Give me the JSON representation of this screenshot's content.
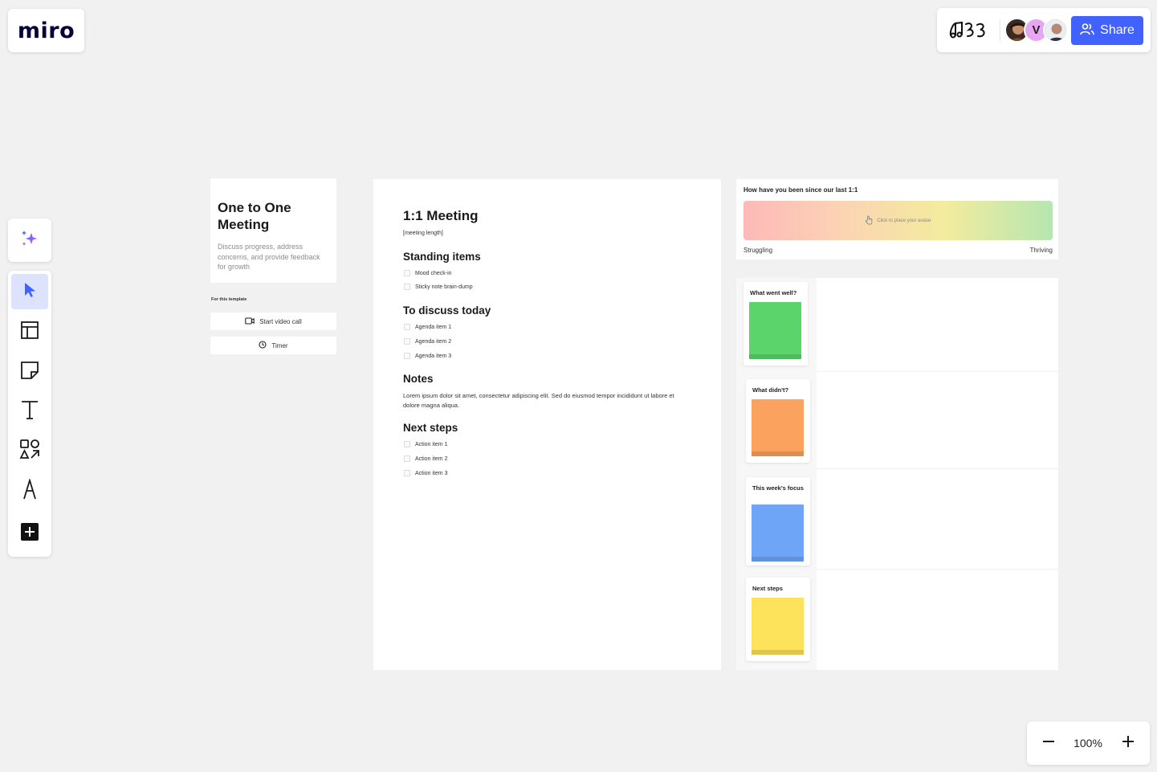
{
  "app": {
    "logo": "miro"
  },
  "topbar": {
    "avatars": [
      {
        "name": "avatar-photo-1"
      },
      {
        "initial": "V"
      },
      {
        "name": "avatar-photo-2"
      }
    ],
    "share_label": "Share"
  },
  "toolbar": {
    "items": [
      "ai-sparkle",
      "select",
      "templates",
      "sticky-note",
      "text",
      "shapes",
      "pen",
      "more"
    ]
  },
  "intro": {
    "title": "One to One Meeting",
    "description": "Discuss progress, address concerns, and provide feedback for growth",
    "for_template": "For this template",
    "video_call_label": "Start video call",
    "timer_label": "Timer"
  },
  "doc": {
    "title": "1:1 Meeting",
    "subtitle": "[meeting length]",
    "standing_heading": "Standing items",
    "standing_items": [
      "Mood check-in",
      "Sticky note brain-dump"
    ],
    "discuss_heading": "To discuss today",
    "discuss_items": [
      "Agenda item 1",
      "Agenda item 2",
      "Agenda item 3"
    ],
    "notes_heading": "Notes",
    "notes_text": "Lorem ipsum dolor sit amet, consectetur adipiscing elit. Sed do eiusmod tempor incididunt ut labore et dolore magna aliqua.",
    "next_heading": "Next steps",
    "next_items": [
      "Action item 1",
      "Action item 2",
      "Action item 3"
    ]
  },
  "mood": {
    "question": "How have you been since our last 1:1",
    "hint": "Click to place your avatar",
    "left_label": "Struggling",
    "right_label": "Thriving"
  },
  "retro": {
    "cards": [
      {
        "label": "What went well?",
        "color": "#5bd46b"
      },
      {
        "label": "What didn't?",
        "color": "#fba25f"
      },
      {
        "label": "This week's focus",
        "color": "#6fa5f7"
      },
      {
        "label": "Next steps",
        "color": "#fde25c"
      }
    ]
  },
  "zoom": {
    "value": "100%"
  },
  "colors": {
    "accent": "#4262ff",
    "active_tool_bg": "#dde3ff"
  }
}
